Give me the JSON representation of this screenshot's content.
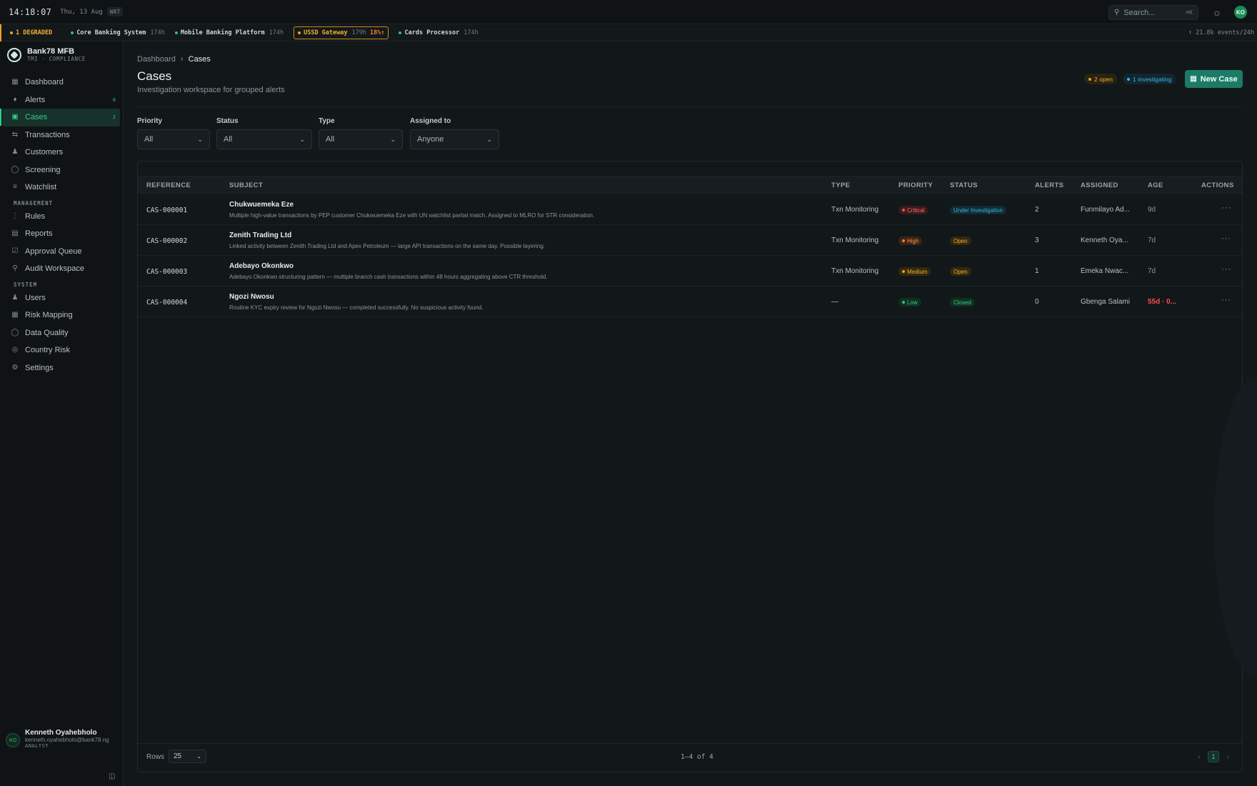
{
  "topbar": {
    "time": "14:18:07",
    "date": "Thu, 13 Aug",
    "timezone": "WAT",
    "search_placeholder": "Search...",
    "search_shortcut": "⌘K",
    "user_initials": "KO"
  },
  "status_strip": {
    "degraded_label": "1 DEGRADED",
    "systems": [
      {
        "name": "Core Banking System",
        "uptime": "174h",
        "state": "ok"
      },
      {
        "name": "Mobile Banking Platform",
        "uptime": "174h",
        "state": "ok"
      },
      {
        "name": "USSD Gateway",
        "uptime": "179h",
        "extra": "18%↑",
        "state": "degraded"
      },
      {
        "name": "Cards Processor",
        "uptime": "174h",
        "state": "ok"
      }
    ],
    "events_rate": "↑ 21.8k events/24h"
  },
  "brand": {
    "name": "Bank78 MFB",
    "subtitle": "TMI · COMPLIANCE"
  },
  "sidebar": {
    "items": [
      {
        "label": "Dashboard",
        "icon": "grid-icon"
      },
      {
        "label": "Alerts",
        "icon": "bell-icon",
        "count": "0"
      },
      {
        "label": "Cases",
        "icon": "folder-icon",
        "count": "2",
        "active": true
      },
      {
        "label": "Transactions",
        "icon": "arrows-icon"
      },
      {
        "label": "Customers",
        "icon": "users-icon"
      },
      {
        "label": "Screening",
        "icon": "shield-icon"
      },
      {
        "label": "Watchlist",
        "icon": "filter-icon"
      }
    ],
    "management_label": "MANAGEMENT",
    "management": [
      {
        "label": "Rules",
        "icon": "sliders-icon"
      },
      {
        "label": "Reports",
        "icon": "document-icon"
      },
      {
        "label": "Approval Queue",
        "icon": "check-square-icon"
      },
      {
        "label": "Audit Workspace",
        "icon": "search-icon"
      }
    ],
    "system_label": "SYSTEM",
    "system": [
      {
        "label": "Users",
        "icon": "user-icon"
      },
      {
        "label": "Risk Mapping",
        "icon": "map-icon"
      },
      {
        "label": "Data Quality",
        "icon": "shield-check-icon"
      },
      {
        "label": "Country Risk",
        "icon": "globe-icon"
      },
      {
        "label": "Settings",
        "icon": "gear-icon"
      }
    ],
    "user": {
      "initials": "KO",
      "name": "Kenneth Oyahebholo",
      "email": "kenneth.oyahebholo@bank78.ng",
      "role": "ANALYST"
    }
  },
  "page": {
    "breadcrumb_root": "Dashboard",
    "breadcrumb_current": "Cases",
    "title": "Cases",
    "subtitle": "Investigation workspace for grouped alerts",
    "open_pill": "2 open",
    "investigating_pill": "1 investigating",
    "new_case_label": "New Case"
  },
  "filters": {
    "priority": {
      "label": "Priority",
      "value": "All"
    },
    "status": {
      "label": "Status",
      "value": "All"
    },
    "type": {
      "label": "Type",
      "value": "All"
    },
    "assigned": {
      "label": "Assigned to",
      "value": "Anyone"
    }
  },
  "table": {
    "columns": [
      "REFERENCE",
      "SUBJECT",
      "TYPE",
      "PRIORITY",
      "STATUS",
      "ALERTS",
      "ASSIGNED",
      "AGE",
      "ACTIONS"
    ],
    "rows": [
      {
        "ref": "CAS-000001",
        "subject": "Chukwuemeka Eze",
        "desc": "Multiple high-value transactions by PEP customer Chukwuemeka Eze with UN watchlist partial match. Assigned to MLRO for STR consideration.",
        "type": "Txn Monitoring",
        "priority": "Critical",
        "status": "Under Investigation",
        "alerts": "2",
        "assigned": "Funmilayo Ad...",
        "age": "9d"
      },
      {
        "ref": "CAS-000002",
        "subject": "Zenith Trading Ltd",
        "desc": "Linked activity between Zenith Trading Ltd and Apex Petroleum — large API transactions on the same day. Possible layering.",
        "type": "Txn Monitoring",
        "priority": "High",
        "status": "Open",
        "alerts": "3",
        "assigned": "Kenneth Oya...",
        "age": "7d"
      },
      {
        "ref": "CAS-000003",
        "subject": "Adebayo Okonkwo",
        "desc": "Adebayo Okonkwo structuring pattern — multiple branch cash transactions within 48 hours aggregating above CTR threshold.",
        "type": "Txn Monitoring",
        "priority": "Medium",
        "status": "Open",
        "alerts": "1",
        "assigned": "Emeka Nwac...",
        "age": "7d"
      },
      {
        "ref": "CAS-000004",
        "subject": "Ngozi Nwosu",
        "desc": "Routine KYC expiry review for Ngozi Nwosu — completed successfully. No suspicious activity found.",
        "type": "—",
        "priority": "Low",
        "status": "Closed",
        "alerts": "0",
        "assigned": "Gbenga Salami",
        "age": "55d · 0..."
      }
    ],
    "rows_label": "Rows",
    "rows_per_page": "25",
    "count_label": "1–4 of 4",
    "current_page": "1"
  }
}
